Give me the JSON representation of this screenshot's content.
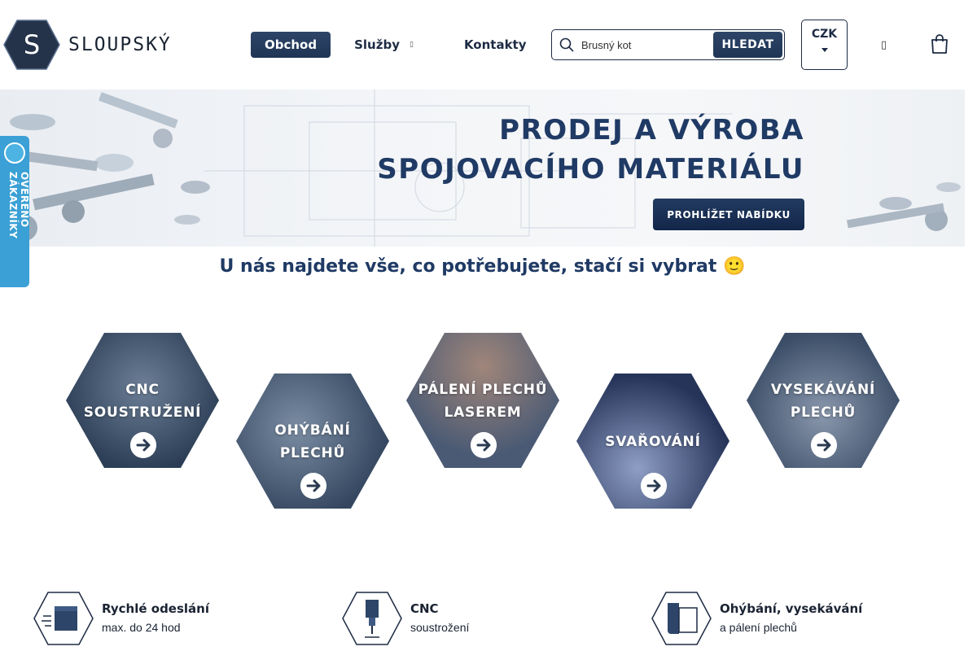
{
  "brand": {
    "name": "SLOUPSKÝ",
    "logo_letter": "S"
  },
  "nav": {
    "items": [
      {
        "label": "Obchod"
      },
      {
        "label": "Služby"
      },
      {
        "label": "Kontakty"
      }
    ]
  },
  "search": {
    "value": "Brusný kot",
    "placeholder": "Brusný kot",
    "button_label": "HLEDAT"
  },
  "currency": {
    "label": "CZK"
  },
  "banner": {
    "title_line1": "PRODEJ A VÝROBA",
    "title_line2": "SPOJOVACÍHO MATERIÁLU",
    "button_label": "PROHLÍŽET NABÍDKU"
  },
  "side_badge": {
    "text": "OVĚŘENO ZÁKAZNÍKY"
  },
  "section": {
    "title": "U nás najdete vše, co potřebujete, stačí si vybrat 🙂"
  },
  "services": [
    {
      "line1": "CNC",
      "line2": "SOUSTRUŽENÍ"
    },
    {
      "line1": "OHÝBÁNÍ",
      "line2": "PLECHŮ"
    },
    {
      "line1": "PÁLENÍ PLECHŮ",
      "line2": "LASEREM"
    },
    {
      "line1": "SVAŘOVÁNÍ",
      "line2": ""
    },
    {
      "line1": "VYSEKÁVÁNÍ",
      "line2": "PLECHŮ"
    }
  ],
  "features": [
    {
      "title": "Rychlé odeslání",
      "sub": "max. do 24 hod",
      "icon": "box-icon"
    },
    {
      "title": "CNC",
      "sub": "soustrožení",
      "icon": "cnc-icon"
    },
    {
      "title": "Ohýbání, vysekávání",
      "sub": "a pálení plechů",
      "icon": "sheet-icon"
    }
  ],
  "colors": {
    "primary": "#1f3a64",
    "accent_badge": "#3aa0d5",
    "button": "#1f3555"
  }
}
